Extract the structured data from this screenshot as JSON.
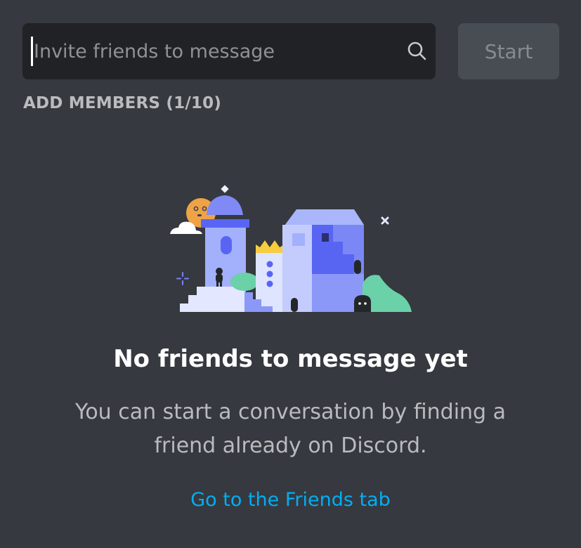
{
  "search": {
    "value": "",
    "placeholder": "Invite friends to message"
  },
  "start_button": {
    "label": "Start"
  },
  "section": {
    "header": "ADD MEMBERS (1/10)"
  },
  "empty_state": {
    "title": "No friends to message yet",
    "description": "You can start a conversation by finding a friend already on Discord.",
    "link": "Go to the Friends tab"
  },
  "colors": {
    "background": "#36393f",
    "input_background": "#202225",
    "button_background": "#4f545c",
    "link": "#00aff4",
    "title": "#ffffff",
    "muted_text": "#b9bbbe"
  },
  "icons": {
    "search": "search-icon",
    "illustration": "empty-friends-illustration"
  }
}
